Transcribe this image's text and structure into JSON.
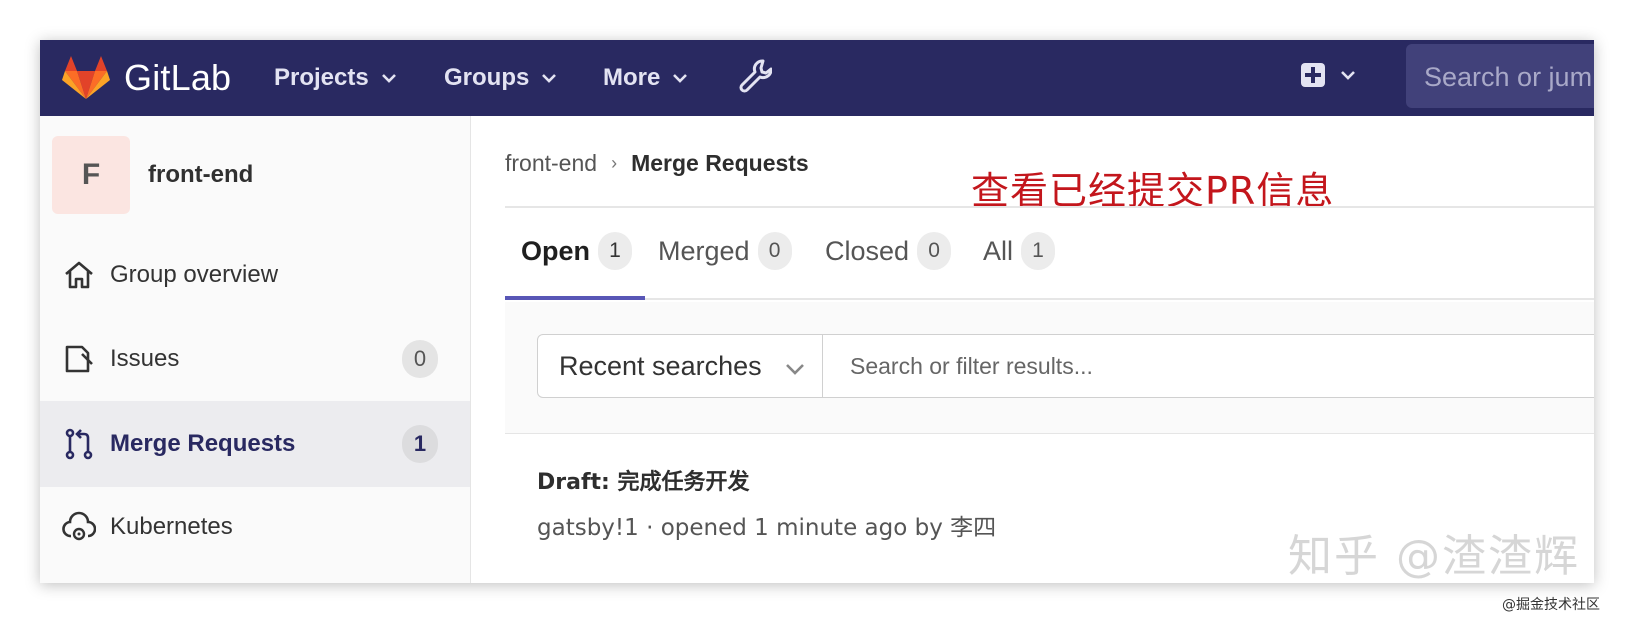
{
  "navbar": {
    "brand": "GitLab",
    "items": [
      {
        "label": "Projects"
      },
      {
        "label": "Groups"
      },
      {
        "label": "More"
      }
    ],
    "search_placeholder": "Search or jum"
  },
  "sidebar": {
    "avatar_letter": "F",
    "group_name": "front-end",
    "items": [
      {
        "label": "Group overview",
        "icon": "home-icon"
      },
      {
        "label": "Issues",
        "count": "0",
        "icon": "issues-icon"
      },
      {
        "label": "Merge Requests",
        "count": "1",
        "icon": "merge-request-icon",
        "active": true
      },
      {
        "label": "Kubernetes",
        "icon": "kubernetes-icon"
      }
    ]
  },
  "breadcrumb": {
    "parent": "front-end",
    "separator": "›",
    "current": "Merge Requests"
  },
  "annotation": "查看已经提交PR信息",
  "tabs": [
    {
      "label": "Open",
      "count": "1",
      "active": true
    },
    {
      "label": "Merged",
      "count": "0"
    },
    {
      "label": "Closed",
      "count": "0"
    },
    {
      "label": "All",
      "count": "1"
    }
  ],
  "filter": {
    "recent_label": "Recent searches",
    "placeholder": "Search or filter results..."
  },
  "merge_request": {
    "title": "Draft: 完成任务开发",
    "meta": "gatsby!1 · opened 1 minute ago by 李四"
  },
  "watermark": "知乎 @渣渣辉",
  "footer_mark": "@掘金技术社区",
  "colors": {
    "navbar_bg": "#292961",
    "active_tab_underline": "#5856b6",
    "annotation": "#c3161c"
  }
}
